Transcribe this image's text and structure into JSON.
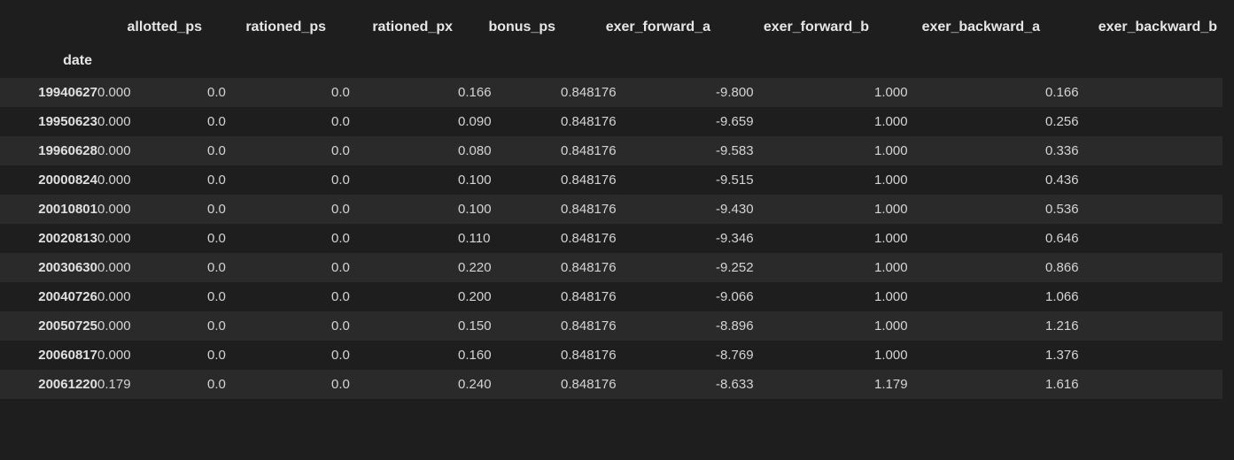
{
  "dataframe": {
    "index_name": "date",
    "columns": [
      "allotted_ps",
      "rationed_ps",
      "rationed_px",
      "bonus_ps",
      "exer_forward_a",
      "exer_forward_b",
      "exer_backward_a",
      "exer_backward_b"
    ],
    "rows": [
      {
        "index": "19940627",
        "values": [
          "0.000",
          "0.0",
          "0.0",
          "0.166",
          "0.848176",
          "-9.800",
          "1.000",
          "0.166"
        ]
      },
      {
        "index": "19950623",
        "values": [
          "0.000",
          "0.0",
          "0.0",
          "0.090",
          "0.848176",
          "-9.659",
          "1.000",
          "0.256"
        ]
      },
      {
        "index": "19960628",
        "values": [
          "0.000",
          "0.0",
          "0.0",
          "0.080",
          "0.848176",
          "-9.583",
          "1.000",
          "0.336"
        ]
      },
      {
        "index": "20000824",
        "values": [
          "0.000",
          "0.0",
          "0.0",
          "0.100",
          "0.848176",
          "-9.515",
          "1.000",
          "0.436"
        ]
      },
      {
        "index": "20010801",
        "values": [
          "0.000",
          "0.0",
          "0.0",
          "0.100",
          "0.848176",
          "-9.430",
          "1.000",
          "0.536"
        ]
      },
      {
        "index": "20020813",
        "values": [
          "0.000",
          "0.0",
          "0.0",
          "0.110",
          "0.848176",
          "-9.346",
          "1.000",
          "0.646"
        ]
      },
      {
        "index": "20030630",
        "values": [
          "0.000",
          "0.0",
          "0.0",
          "0.220",
          "0.848176",
          "-9.252",
          "1.000",
          "0.866"
        ]
      },
      {
        "index": "20040726",
        "values": [
          "0.000",
          "0.0",
          "0.0",
          "0.200",
          "0.848176",
          "-9.066",
          "1.000",
          "1.066"
        ]
      },
      {
        "index": "20050725",
        "values": [
          "0.000",
          "0.0",
          "0.0",
          "0.150",
          "0.848176",
          "-8.896",
          "1.000",
          "1.216"
        ]
      },
      {
        "index": "20060817",
        "values": [
          "0.000",
          "0.0",
          "0.0",
          "0.160",
          "0.848176",
          "-8.769",
          "1.000",
          "1.376"
        ]
      },
      {
        "index": "20061220",
        "values": [
          "0.179",
          "0.0",
          "0.0",
          "0.240",
          "0.848176",
          "-8.633",
          "1.179",
          "1.616"
        ]
      }
    ]
  }
}
